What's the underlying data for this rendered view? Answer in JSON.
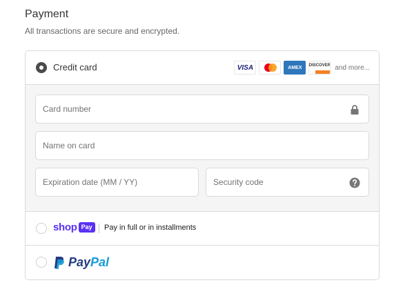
{
  "header": {
    "title": "Payment",
    "subtitle": "All transactions are secure and encrypted."
  },
  "credit_card": {
    "label": "Credit card",
    "selected": true,
    "logos": {
      "visa": "VISA",
      "amex": "AMEX",
      "discover": "DISCOVER"
    },
    "more_text": "and more..."
  },
  "form": {
    "card_number_placeholder": "Card number",
    "name_on_card_placeholder": "Name on card",
    "expiration_placeholder": "Expiration date (MM / YY)",
    "security_code_placeholder": "Security code"
  },
  "shop_pay": {
    "logo_text": "shop",
    "badge_text": "Pay",
    "description": "Pay in full or in installments",
    "selected": false
  },
  "paypal": {
    "logo_pay": "Pay",
    "logo_pal": "Pal",
    "selected": false
  },
  "colors": {
    "shop_pay_purple": "#5a31f4",
    "paypal_dark": "#253b80",
    "paypal_light": "#179bd7",
    "form_bg": "#f5f5f5",
    "border": "#d9d9d9"
  },
  "icons": {
    "card_number": "lock-icon",
    "security_code": "question-circle-icon",
    "paypal": "paypal-p-icon"
  }
}
